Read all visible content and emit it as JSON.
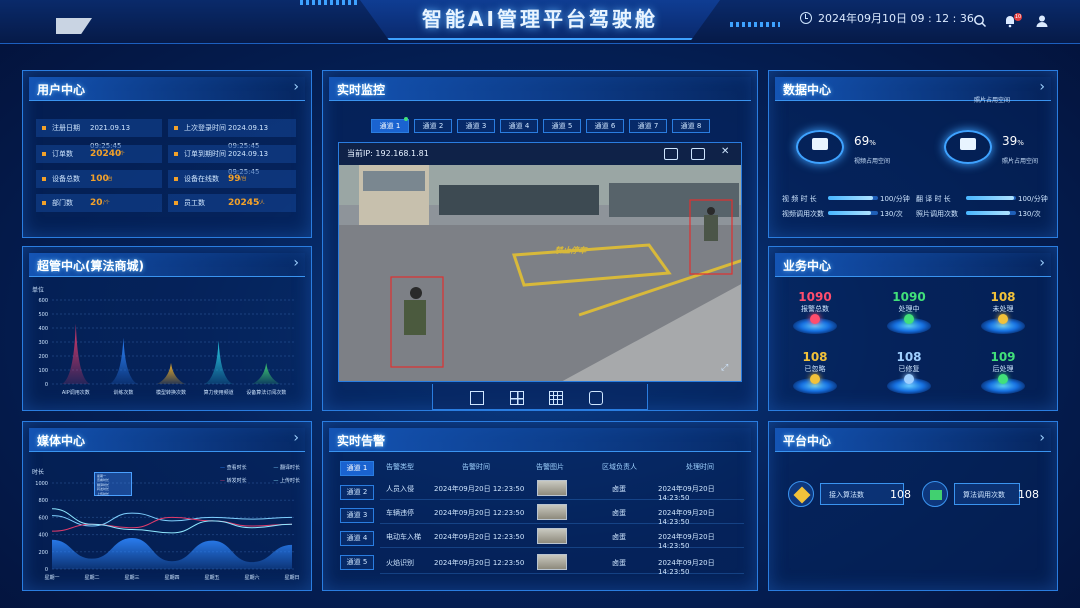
{
  "header": {
    "title": "智能AI管理平台驾驶舱",
    "datetime": "2024年09月10日 09 : 12 : 36",
    "notification_count": "10"
  },
  "user_center": {
    "title": "用户中心",
    "rows": [
      {
        "label": "注册日期",
        "value": "2021.09.13 09:25:45"
      },
      {
        "label": "上次登录时间",
        "value": "2024.09.13 09:25:45"
      },
      {
        "label": "订单数",
        "value": "20240",
        "unit": "/个"
      },
      {
        "label": "订单到期时间",
        "value": "2024.09.13 09:25:45"
      },
      {
        "label": "设备总数",
        "value": "100",
        "unit": "/台"
      },
      {
        "label": "设备在线数",
        "value": "99",
        "unit": "/台"
      },
      {
        "label": "部门数",
        "value": "20",
        "unit": "/个"
      },
      {
        "label": "员工数",
        "value": "20245",
        "unit": "/人"
      }
    ]
  },
  "mall": {
    "title": "超管中心(算法商城)",
    "unit_label": "单位",
    "y_ticks": [
      "600",
      "500",
      "400",
      "300",
      "200",
      "100",
      "0"
    ]
  },
  "media": {
    "title": "媒体中心",
    "y_label": "时长",
    "legend": [
      "查看时长",
      "翻译时长",
      "转发时长",
      "上传时长"
    ],
    "tooltip": [
      "星期一",
      "查看时长",
      "翻译时长",
      "转发时长",
      "上传时长"
    ]
  },
  "monitor": {
    "title": "实时监控",
    "channels": [
      "通道 1",
      "通道 2",
      "通道 3",
      "通道 4",
      "通道 5",
      "通道 6",
      "通道 7",
      "通道 8"
    ],
    "current_ip_label": "当前IP: 192.168.1.81",
    "road_text": "禁止停车"
  },
  "alarm": {
    "title": "实时告警",
    "channels": [
      "通道 1",
      "通道 2",
      "通道 3",
      "通道 4",
      "通道 5"
    ],
    "headers": [
      "告警类型",
      "告警时间",
      "告警图片",
      "区域负责人",
      "处理时间"
    ],
    "rows": [
      {
        "type": "人员入侵",
        "time": "2024年09月20日 12:23:50",
        "owner": "卤蛋",
        "handled": "2024年09月20日 14:23:50"
      },
      {
        "type": "车辆违停",
        "time": "2024年09月20日 12:23:50",
        "owner": "卤蛋",
        "handled": "2024年09月20日 14:23:50"
      },
      {
        "type": "电动车入梯",
        "time": "2024年09月20日 12:23:50",
        "owner": "卤蛋",
        "handled": "2024年09月20日 14:23:50"
      },
      {
        "type": "火焰识别",
        "time": "2024年09月20日 12:23:50",
        "owner": "卤蛋",
        "handled": "2024年09月20日 14:23:50"
      }
    ]
  },
  "data_center": {
    "title": "数据中心",
    "subtitle": "照片占用空间",
    "video_pct": "69",
    "video_label": "视频占用空间",
    "photo_pct": "39",
    "photo_label": "照片占用空间",
    "stats": [
      {
        "label": "视 频 时 长",
        "value": "100/分钟",
        "fill": 0.9
      },
      {
        "label": "翻 译 时 长",
        "value": "100/分钟",
        "fill": 0.95
      },
      {
        "label": "视频调用次数",
        "value": "130/次",
        "fill": 0.85
      },
      {
        "label": "照片调用次数",
        "value": "130/次",
        "fill": 0.88
      }
    ],
    "colors": {
      "accent": "#48b6ff"
    }
  },
  "business": {
    "title": "业务中心",
    "items": [
      {
        "value": "1090",
        "label": "报警总数",
        "color": "#ff4d6d"
      },
      {
        "value": "1090",
        "label": "处理中",
        "color": "#41e07a"
      },
      {
        "value": "108",
        "label": "未处理",
        "color": "#f2c23a"
      },
      {
        "value": "108",
        "label": "已忽略",
        "color": "#f2c23a"
      },
      {
        "value": "108",
        "label": "已修复",
        "color": "#9fcfff"
      },
      {
        "value": "109",
        "label": "后处理",
        "color": "#41e07a"
      }
    ]
  },
  "platform": {
    "title": "平台中心",
    "items": [
      {
        "label": "接入算法数",
        "value": "108"
      },
      {
        "label": "算法调用次数",
        "value": "108"
      }
    ]
  },
  "chart_data": [
    {
      "type": "area",
      "title": "超管中心(算法商城)",
      "ylabel": "单位",
      "categories": [
        "AIP调用次数",
        "训练次数",
        "模型转换次数",
        "算力使用频道",
        "设备算法订阅次数"
      ],
      "values": [
        430,
        330,
        150,
        310,
        150
      ],
      "colors": [
        "#e23b6b",
        "#2d86ff",
        "#f2b22a",
        "#2ad0e8",
        "#41d070"
      ],
      "ylim": [
        0,
        600
      ]
    },
    {
      "type": "area",
      "title": "媒体中心",
      "ylabel": "时长",
      "categories": [
        "星期一",
        "星期二",
        "星期三",
        "星期四",
        "星期五",
        "星期六",
        "星期日"
      ],
      "ylim": [
        0,
        1000
      ],
      "y_ticks": [
        1000,
        800,
        600,
        400,
        200,
        0
      ],
      "series": [
        {
          "name": "查看时长",
          "values": [
            340,
            120,
            360,
            90,
            330,
            80,
            280
          ],
          "color": "#2d86ff"
        },
        {
          "name": "翻译时长",
          "values": [
            620,
            500,
            650,
            560,
            600,
            580,
            600
          ],
          "color": "#7fd0ff"
        },
        {
          "name": "转发时长",
          "values": [
            440,
            520,
            480,
            600,
            560,
            500,
            520
          ],
          "color": "#e23b6b"
        },
        {
          "name": "上传时长",
          "values": [
            700,
            520,
            460,
            420,
            560,
            480,
            520
          ],
          "color": "#8fe8ff"
        }
      ]
    }
  ]
}
